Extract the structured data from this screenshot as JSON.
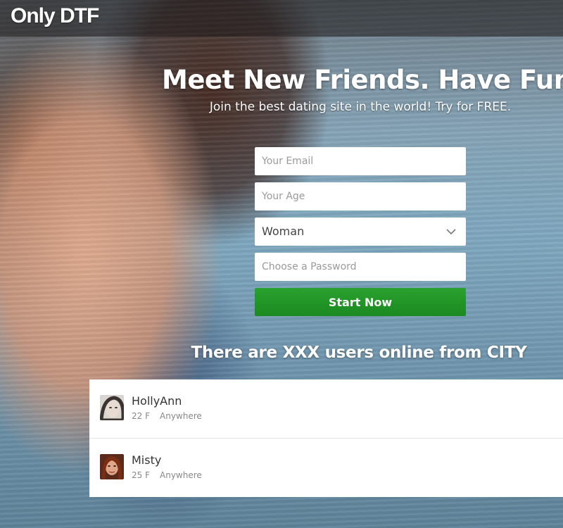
{
  "brand": {
    "logo_text": "Only DTF"
  },
  "hero": {
    "headline": "Meet New Friends. Have Fun.",
    "subheadline": "Join the best dating site in the world! Try for FREE."
  },
  "signup_form": {
    "email_placeholder": "Your Email",
    "age_placeholder": "Your Age",
    "gender_selected": "Woman",
    "password_placeholder": "Choose a Password",
    "submit_label": "Start Now"
  },
  "online_banner": "There are XXX users online from CITY",
  "users": [
    {
      "name": "HollyAnn",
      "age_gender": "22 F",
      "location": "Anywhere"
    },
    {
      "name": "Misty",
      "age_gender": "25 F",
      "location": "Anywhere"
    }
  ],
  "colors": {
    "cta_green": "#1f9424",
    "topbar": "#2a2323",
    "text_light": "#ffffff"
  },
  "icons": [
    "chevron-down-icon"
  ]
}
